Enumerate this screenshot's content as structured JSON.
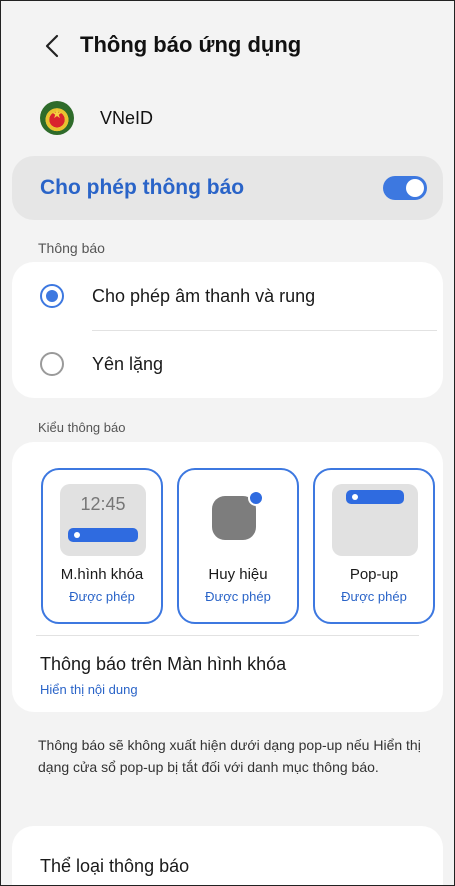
{
  "header": {
    "title": "Thông báo ứng dụng",
    "back_icon": "chevron-left-icon"
  },
  "app": {
    "name": "VNeID"
  },
  "allow": {
    "label": "Cho phép thông báo",
    "enabled": true,
    "accent": "#3d78e0"
  },
  "notifications": {
    "section_label": "Thông báo",
    "options": [
      {
        "label": "Cho phép âm thanh và rung",
        "selected": true
      },
      {
        "label": "Yên lặng",
        "selected": false
      }
    ]
  },
  "styles": {
    "section_label": "Kiểu thông báo",
    "options": [
      {
        "title": "M.hình khóa",
        "status": "Được phép",
        "preview_time": "12:45"
      },
      {
        "title": "Huy hiệu",
        "status": "Được phép"
      },
      {
        "title": "Pop-up",
        "status": "Được phép"
      }
    ],
    "lock_screen": {
      "title": "Thông báo trên Màn hình khóa",
      "value": "Hiển thị nội dung"
    }
  },
  "info": "Thông báo sẽ không xuất hiện dưới dạng pop-up nếu Hiển thị dạng cửa sổ pop-up bị tắt đối với danh mục thông báo.",
  "categories": {
    "label": "Thể loại thông báo"
  }
}
